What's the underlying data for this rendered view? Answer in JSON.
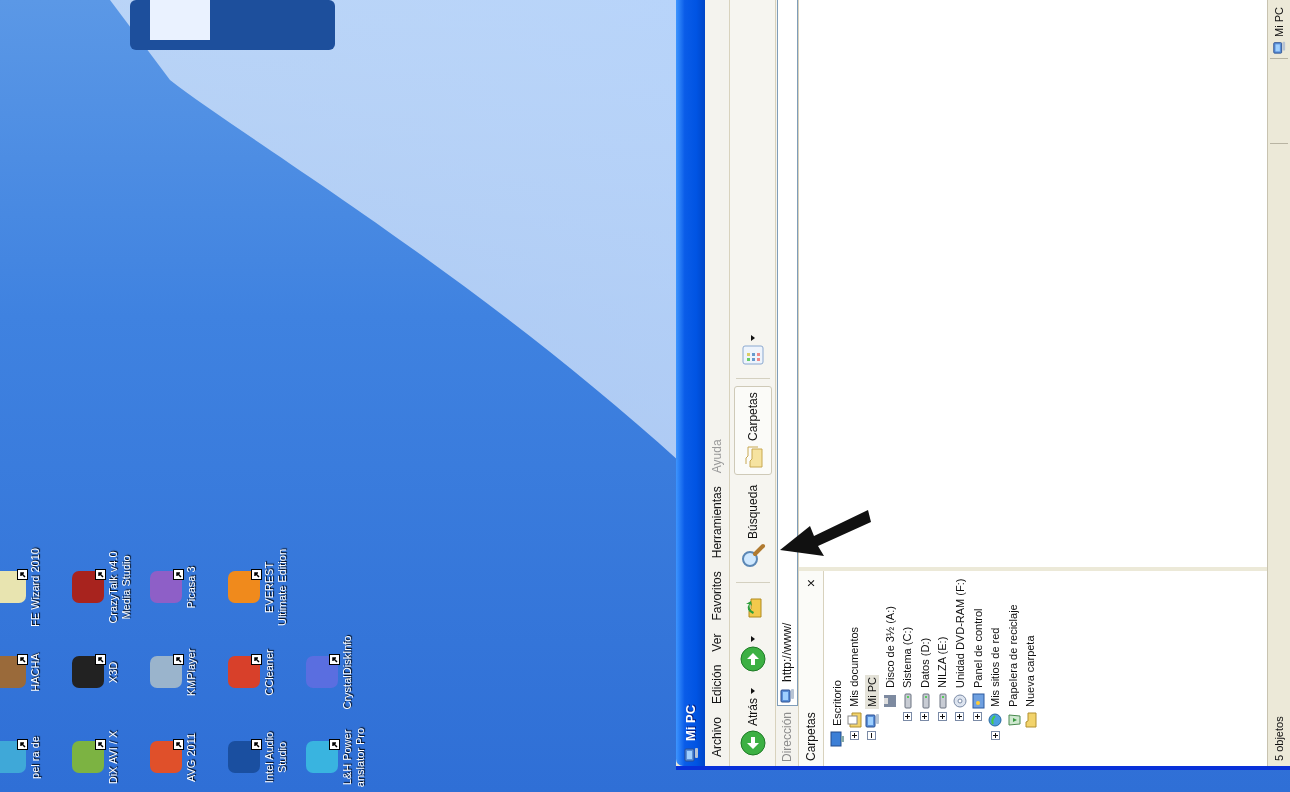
{
  "desktop": {
    "icons": [
      {
        "label": "pel ra de",
        "color": "#3fa8d8"
      },
      {
        "label": "HACHA",
        "color": "#9a6a3a"
      },
      {
        "label": "FE Wizard 2010",
        "color": "#e8e4b0"
      },
      {
        "label": "DiX AVI / X",
        "color": "#7cb342"
      },
      {
        "label": "X3D",
        "color": "#222222"
      },
      {
        "label": "CrazyTalk v4.0 Media Studio",
        "color": "#a8231e"
      },
      {
        "label": "AVG 2011",
        "color": "#e0502a"
      },
      {
        "label": "KMPlayer",
        "color": "#9ab4cc"
      },
      {
        "label": "Picasa 3",
        "color": "#8e5fc7"
      },
      {
        "label": "Intel Audio Studio",
        "color": "#1a4fa0"
      },
      {
        "label": "CCleaner",
        "color": "#d8402a"
      },
      {
        "label": "EVEREST Ultimate Edition",
        "color": "#f08a1c"
      },
      {
        "label": "L&H Power anslator Pro",
        "color": "#39b4e0"
      },
      {
        "label": "CrystalDiskInfo",
        "color": "#5a6ee0"
      }
    ]
  },
  "window": {
    "title": "Mi PC",
    "menu": [
      "Archivo",
      "Edición",
      "Ver",
      "Favoritos",
      "Herramientas",
      "Ayuda"
    ],
    "toolbar": [
      {
        "kind": "back",
        "label": "Atrás"
      },
      {
        "kind": "forward"
      },
      {
        "kind": "up"
      },
      {
        "kind": "search",
        "label": "Búsqueda"
      },
      {
        "kind": "folders",
        "label": "Carpetas",
        "selected": true
      },
      {
        "kind": "views"
      }
    ],
    "address": {
      "label": "Dirección",
      "value": "http://www/"
    },
    "folders_pane": {
      "title": "Carpetas",
      "close": "×",
      "tree": [
        {
          "label": "Escritorio",
          "kind": "desktop",
          "selected": false,
          "children": [
            {
              "label": "Mis documentos",
              "kind": "documents",
              "selected": false,
              "expanded": false
            },
            {
              "label": "Mi PC",
              "kind": "computer",
              "selected": true,
              "expanded": true,
              "children": [
                {
                  "label": "Disco de 3½ (A:)",
                  "kind": "floppy",
                  "selected": false
                },
                {
                  "label": "Sistema (C:)",
                  "kind": "drive",
                  "selected": false,
                  "expanded": false
                },
                {
                  "label": "Datos (D:)",
                  "kind": "drive",
                  "selected": false,
                  "expanded": false
                },
                {
                  "label": "NILZA (E:)",
                  "kind": "drive",
                  "selected": false,
                  "expanded": false
                },
                {
                  "label": "Unidad DVD-RAM (F:)",
                  "kind": "cdrom",
                  "selected": false,
                  "expanded": false
                },
                {
                  "label": "Panel de control",
                  "kind": "control",
                  "selected": false,
                  "expanded": false
                }
              ]
            },
            {
              "label": "Mis sitios de red",
              "kind": "network",
              "selected": false,
              "expanded": false
            },
            {
              "label": "Papelera de reciclaje",
              "kind": "recycle",
              "selected": false
            },
            {
              "label": "Nueva carpeta",
              "kind": "folder",
              "selected": false
            }
          ]
        }
      ]
    },
    "status_bar": {
      "left": "5 objetos",
      "right": "Mi PC"
    }
  }
}
